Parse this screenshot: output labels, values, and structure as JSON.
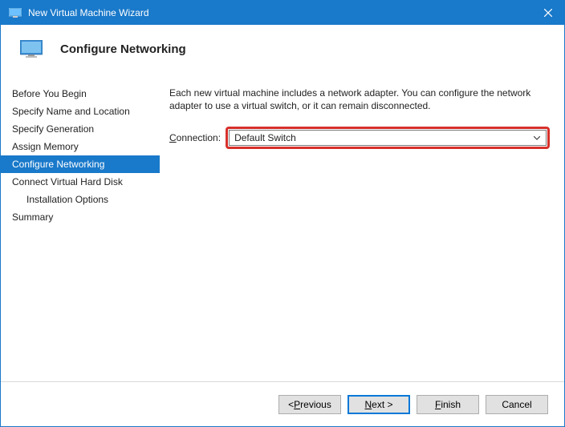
{
  "titlebar": {
    "title": "New Virtual Machine Wizard"
  },
  "header": {
    "title": "Configure Networking"
  },
  "sidebar": {
    "items": [
      {
        "label": "Before You Begin",
        "indent": false,
        "selected": false
      },
      {
        "label": "Specify Name and Location",
        "indent": false,
        "selected": false
      },
      {
        "label": "Specify Generation",
        "indent": false,
        "selected": false
      },
      {
        "label": "Assign Memory",
        "indent": false,
        "selected": false
      },
      {
        "label": "Configure Networking",
        "indent": false,
        "selected": true
      },
      {
        "label": "Connect Virtual Hard Disk",
        "indent": false,
        "selected": false
      },
      {
        "label": "Installation Options",
        "indent": true,
        "selected": false
      },
      {
        "label": "Summary",
        "indent": false,
        "selected": false
      }
    ]
  },
  "main": {
    "description": "Each new virtual machine includes a network adapter. You can configure the network adapter to use a virtual switch, or it can remain disconnected.",
    "connection": {
      "label_prefix": "C",
      "label_rest": "onnection:",
      "value": "Default Switch"
    }
  },
  "footer": {
    "previous_prefix": "< ",
    "previous_uchar": "P",
    "previous_rest": "revious",
    "next_uchar": "N",
    "next_rest": "ext >",
    "finish_uchar": "F",
    "finish_rest": "inish",
    "cancel": "Cancel"
  }
}
